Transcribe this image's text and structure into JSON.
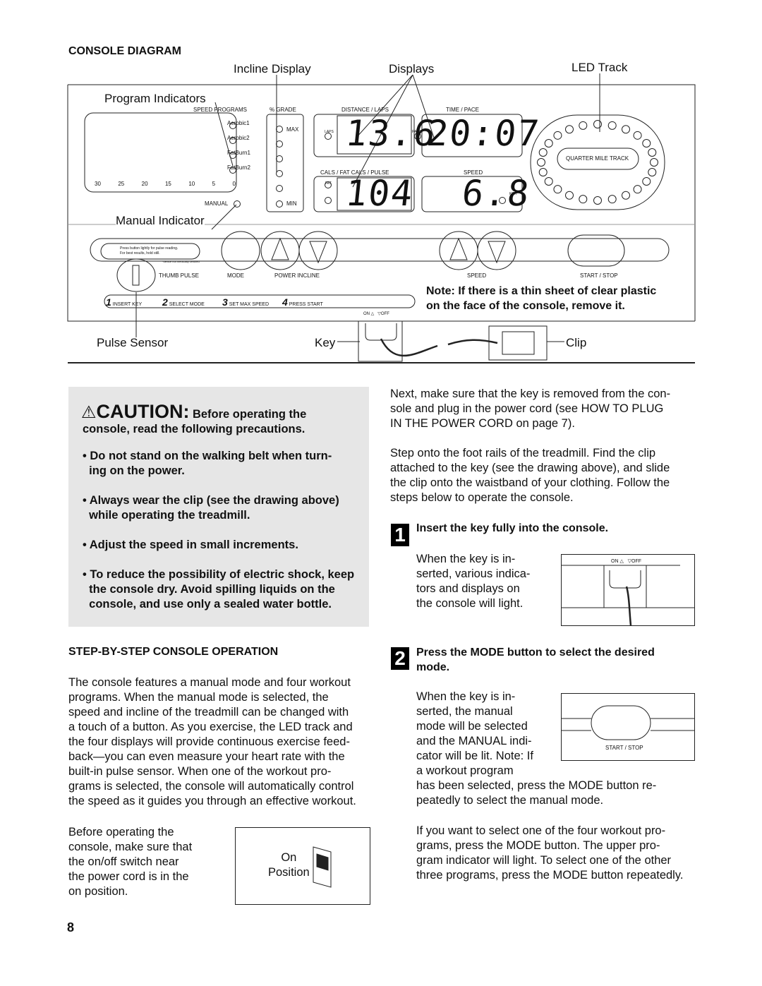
{
  "section_title": "CONSOLE DIAGRAM",
  "callouts": {
    "incline_display": "Incline Display",
    "displays": "Displays",
    "led_track": "LED Track",
    "program_indicators": "Program Indicators",
    "manual_indicator": "Manual Indicator",
    "pulse_sensor": "Pulse Sensor",
    "key": "Key",
    "clip": "Clip"
  },
  "console": {
    "speed_programs": "SPEED PROGRAMS",
    "grade": "% GRADE",
    "max": "MAX",
    "min": "MIN",
    "programs": [
      "Aerobic1",
      "Aerobic2",
      "FatBurn1",
      "FatBurn2"
    ],
    "scale": [
      "30",
      "25",
      "20",
      "15",
      "10",
      "5",
      "0"
    ],
    "manual": "MANUAL",
    "distance_laps": "DISTANCE / LAPS",
    "time_pace": "TIME / PACE",
    "cals": "CALS / FAT CALS / PULSE",
    "speed_hdr": "SPEED",
    "laps": "LAPS",
    "pace": "PACE",
    "fat": "FAT",
    "kph": "KPH",
    "distance_value": "13.6",
    "time_value": "20:07",
    "cals_value": "104",
    "speed_value": "6.8",
    "quarter_mile_track": "QUARTER MILE TRACK",
    "pulse_note1": "Press button lightly for pulse reading.",
    "pulse_note2": "For best results, hold still.",
    "pulse_note3": "*device not medically certified",
    "thumb_pulse": "THUMB PULSE",
    "mode": "MODE",
    "power_incline": "POWER INCLINE",
    "speed": "SPEED",
    "start_stop": "START / STOP",
    "steps": [
      {
        "n": "1",
        "label": "INSERT KEY"
      },
      {
        "n": "2",
        "label": "SELECT MODE"
      },
      {
        "n": "3",
        "label": "SET MAX SPEED"
      },
      {
        "n": "4",
        "label": "PRESS START"
      }
    ],
    "on": "ON",
    "off": "OFF"
  },
  "note": [
    "Note: If there is a thin sheet of clear plastic",
    "on the face of the console, remove it."
  ],
  "caution": {
    "word": "CAUTION:",
    "lead1": "Before operating the",
    "lead2": "console, read the following precautions.",
    "bullets": [
      [
        "Do not stand on the walking belt when turn-",
        "ing on the power."
      ],
      [
        "Always wear the clip (see the drawing above)",
        "while operating the treadmill."
      ],
      [
        "Adjust the speed in small increments."
      ],
      [
        "To reduce the possibility of electric shock, keep",
        "the console dry. Avoid spilling liquids on the",
        "console, and use only a sealed water bottle."
      ]
    ]
  },
  "step_by_step": {
    "title": "STEP-BY-STEP CONSOLE OPERATION",
    "para": [
      "The console features a manual mode and four workout",
      "programs. When the manual mode is selected, the",
      "speed and incline of the treadmill can be changed with",
      "a touch of a button. As you exercise, the LED track and",
      "the four displays will provide continuous exercise feed-",
      "back—you can even measure your heart rate with the",
      "built-in pulse sensor. When one of the workout pro-",
      "grams is selected, the console will automatically control",
      "the speed as it guides you through an effective workout."
    ],
    "before": [
      "Before operating the",
      "console, make sure that",
      "the on/off switch near",
      "the power cord is in the",
      "on position."
    ],
    "on_position": [
      "On",
      "Position"
    ]
  },
  "right": {
    "p1": [
      "Next, make sure that the key is removed from the con-",
      "sole and plug in the power cord (see HOW TO PLUG",
      "IN THE POWER CORD on page 7)."
    ],
    "p2": [
      "Step onto the foot rails of the treadmill. Find the clip",
      "attached to the key (see the drawing above), and slide",
      "the clip onto the waistband of your clothing. Follow the",
      "steps below to operate the console."
    ],
    "step1": {
      "num": "1",
      "title": "Insert the key fully into the console.",
      "text": [
        "When the key is in-",
        "serted, various indica-",
        "tors and displays on",
        "the console will light."
      ]
    },
    "step2": {
      "num": "2",
      "title": [
        "Press the MODE button to select the desired",
        "mode."
      ],
      "text": [
        "When the key is in-",
        "serted, the manual",
        "mode will be selected",
        "and the MANUAL indi-",
        "cator will be lit. Note: If",
        "a workout program"
      ],
      "text2": [
        "has been selected, press the MODE button re-",
        "peatedly to select the manual mode."
      ]
    },
    "p3": [
      "If you want to select one of the four workout pro-",
      "grams, press the MODE button. The upper pro-",
      "gram indicator will light. To select one of the other",
      "three programs, press the MODE button repeatedly."
    ]
  },
  "page_number": "8"
}
